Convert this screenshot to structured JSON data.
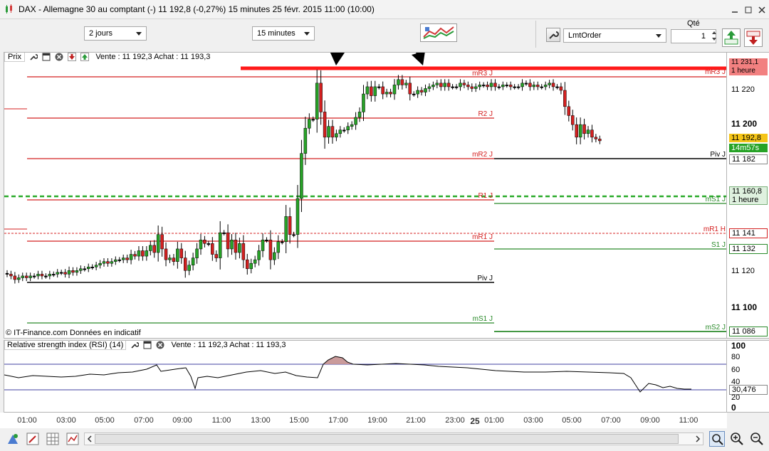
{
  "window": {
    "title": "DAX - Allemagne 30 au comptant (-)   11 192,8 (-0,27%)   15 minutes  25 févr. 2015 11:00 (10:00)"
  },
  "toolbar": {
    "period": "2 jours",
    "interval": "15 minutes",
    "qty_label": "Qté",
    "qty_value": "1",
    "order_type": "LmtOrder"
  },
  "price_pane": {
    "title": "Prix",
    "quote": "Vente : 11 192,3 Achat : 11 193,3",
    "copyright": "© IT-Finance.com  Données en indicatif"
  },
  "rsi_pane": {
    "title": "Relative strength index (RSI) (14)",
    "quote": "Vente : 11 192,3 Achat : 11 193,3",
    "current_value": "30,476"
  },
  "price_axis": {
    "ticks": [
      "11 220",
      "11 200",
      "11 120",
      "11 100"
    ],
    "tags": {
      "mr3": "11 231,1",
      "mr3_sub": "1 heure",
      "current": "11 192,8",
      "countdown": "14m57s",
      "piv": "11 182",
      "dashed": "11 160,8",
      "dashed_sub": "1 heure",
      "mr1h": "11 141",
      "s1": "11 132",
      "ms2": "11 086"
    }
  },
  "rsi_axis": {
    "ticks": [
      "100",
      "80",
      "60",
      "40",
      "20",
      "0"
    ]
  },
  "levels": {
    "mr3_j": "mR3 J",
    "r2_j": "R2 J",
    "mr2_j": "mR2 J",
    "r1_j": "R1 J",
    "mr1_j": "mR1 J",
    "piv_j": "Piv J",
    "ms1_j": "mS1 J",
    "mr3_j_right": "mR3 J",
    "piv_j_right": "Piv J",
    "ms1_j_right": "mS1 J",
    "mr1_h": "mR1 H",
    "s1_j": "S1 J",
    "ms2_j": "mS2 J"
  },
  "time_axis": {
    "labels": [
      "01:00",
      "03:00",
      "05:00",
      "07:00",
      "09:00",
      "11:00",
      "13:00",
      "15:00",
      "17:00",
      "19:00",
      "21:00",
      "23:00",
      "25",
      "01:00",
      "03:00",
      "05:00",
      "07:00",
      "09:00",
      "11:00"
    ]
  },
  "chart_data": {
    "type": "candlestick",
    "title": "DAX - Allemagne 30 au comptant (-)",
    "interval": "15 minutes",
    "y_ticks": [
      11100,
      11120,
      11200,
      11220
    ],
    "x_ticks": [
      "01:00",
      "03:00",
      "05:00",
      "07:00",
      "09:00",
      "11:00",
      "13:00",
      "15:00",
      "17:00",
      "19:00",
      "21:00",
      "23:00",
      "25",
      "01:00",
      "03:00",
      "05:00",
      "07:00",
      "09:00",
      "11:00"
    ],
    "last_price": 11192.8,
    "levels_day1": [
      {
        "name": "mR3 J",
        "value": 11226
      },
      {
        "name": "R2 J",
        "value": 11202
      },
      {
        "name": "mR2 J",
        "value": 11182
      },
      {
        "name": "R1 J",
        "value": 11158
      },
      {
        "name": "mR1 J",
        "value": 11138
      },
      {
        "name": "Piv J",
        "value": 11115
      },
      {
        "name": "mS1 J",
        "value": 11093
      }
    ],
    "levels_day2": [
      {
        "name": "mR3 J",
        "value": 11231.1
      },
      {
        "name": "Piv J",
        "value": 11182
      },
      {
        "name": "mS1 J",
        "value": 11156
      },
      {
        "name": "mR1 H",
        "value": 11141
      },
      {
        "name": "S1 J",
        "value": 11132
      },
      {
        "name": "mS2 J",
        "value": 11086
      }
    ],
    "highlight_level": 11231.1,
    "dashed_level": 11160.8,
    "candles_close": [
      11118,
      11117,
      11115,
      11116,
      11117,
      11116,
      11117,
      11117,
      11118,
      11117,
      11117,
      11118,
      11118,
      11119,
      11119,
      11118,
      11120,
      11119,
      11120,
      11121,
      11121,
      11122,
      11122,
      11123,
      11124,
      11125,
      11124,
      11125,
      11126,
      11126,
      11127,
      11126,
      11129,
      11128,
      11131,
      11128,
      11131,
      11134,
      11130,
      11140,
      11132,
      11126,
      11127,
      11125,
      11132,
      11127,
      11120,
      11123,
      11127,
      11132,
      11137,
      11135,
      11135,
      11129,
      11127,
      11141,
      11141,
      11132,
      11137,
      11130,
      11135,
      11126,
      11121,
      11124,
      11126,
      11131,
      11137,
      11137,
      11126,
      11130,
      11136,
      11136,
      11150,
      11140,
      11140,
      11160,
      11185,
      11199,
      11204,
      11204,
      11224,
      11208,
      11194,
      11200,
      11194,
      11196,
      11198,
      11198,
      11200,
      11201,
      11205,
      11208,
      11218,
      11222,
      11217,
      11222,
      11222,
      11218,
      11219,
      11218,
      11223,
      11226,
      11223,
      11224,
      11218,
      11218,
      11220,
      11219,
      11221,
      11222,
      11223,
      11224,
      11222,
      11224,
      11222,
      11222,
      11222,
      11224,
      11223,
      11222,
      11221,
      11222,
      11223,
      11223,
      11222,
      11224,
      11222,
      11222,
      11223,
      11223,
      11222,
      11222,
      11222,
      11224,
      11224,
      11222,
      11223,
      11222,
      11222,
      11223,
      11224,
      11222,
      11222,
      11220,
      11211,
      11206,
      11201,
      11194,
      11201,
      11196,
      11198,
      11194,
      11193,
      11192
    ],
    "rsi": {
      "title": "Relative strength index (RSI) (14)",
      "ylim": [
        0,
        100
      ],
      "levels": [
        70,
        30
      ],
      "last": 30.476
    }
  }
}
